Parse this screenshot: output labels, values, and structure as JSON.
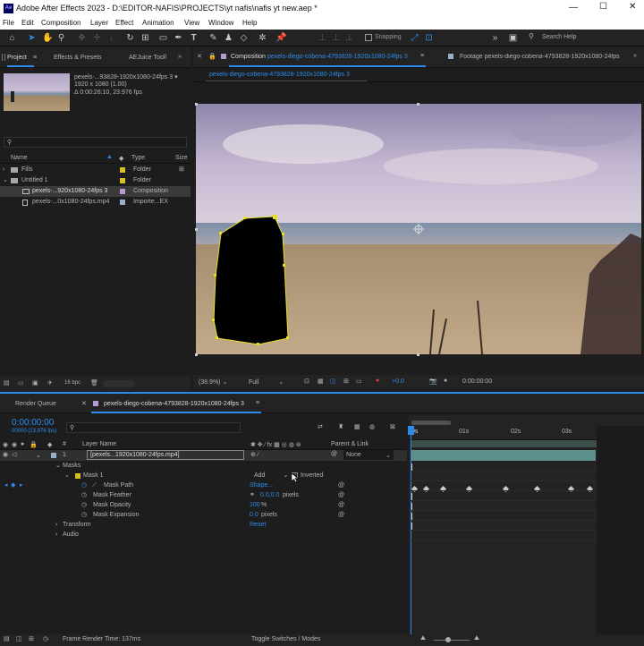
{
  "app": {
    "title": "Adobe After Effects 2023 - D:\\EDITOR-NAFIS\\PROJECTS\\yt nafis\\nafis yt new.aep *",
    "logo": "Ae",
    "win_controls": [
      "—",
      "☐",
      "✕"
    ]
  },
  "menu": [
    "File",
    "Edit",
    "Composition",
    "Layer",
    "Effect",
    "Animation",
    "View",
    "Window",
    "Help"
  ],
  "toolbar": {
    "snapping": "Snapping",
    "search_placeholder": "Search Help"
  },
  "project_panel": {
    "tabs": [
      "Project",
      "Effects & Presets",
      "AEJuice Tooll"
    ],
    "preview": {
      "name": "pexels-...93828-1920x1080-24fps 3 ▾",
      "res": "1920 x 1080 (1.00)",
      "dur": "Δ 0:00:26:10, 23.976 fps"
    },
    "columns": {
      "name": "Name",
      "type": "Type",
      "size": "Size"
    },
    "items": [
      {
        "name": "Fills",
        "type": "Folder"
      },
      {
        "name": "Untitled 1",
        "type": "Folder"
      },
      {
        "name": "pexels-...920x1080-24fps 3",
        "type": "Composition"
      },
      {
        "name": "pexels-...0x1080-24fps.mp4",
        "type": "Importe...EX"
      }
    ],
    "bpc": "16 bpc"
  },
  "comp_panel": {
    "tab_comp_prefix": "Composition",
    "tab_comp_name": "pexels-diego-cobena-4793828-1920x1080-24fps 3",
    "tab_footage": "Footage pexels-diego-cobena-4793828-1920x1080-24fps",
    "subtab": "pexels-diego-cobena-4793828-1920x1080-24fps 3",
    "zoom": "(38.9%)",
    "resolution": "Full",
    "exposure": "+0.0",
    "timecode": "0:00:00:00"
  },
  "timeline": {
    "tab_render": "Render Queue",
    "tab_comp": "pexels-diego-cobena-4793828-1920x1080-24fps 3",
    "timecode": "0:00:00:00",
    "timecode_sub": "00000 (23.976 fps)",
    "cols": {
      "layer": "Layer Name",
      "parent": "Parent & Link"
    },
    "layer": {
      "num": "1",
      "name": "[pexels...1920x1080-24fps.mp4]",
      "parent": "None"
    },
    "props": [
      {
        "label": "Masks"
      },
      {
        "label": "Mask 1",
        "mode": "Add",
        "inverted": "Inverted"
      },
      {
        "label": "Mask Path",
        "value": "Shape..."
      },
      {
        "label": "Mask Feather",
        "value": "0.0,0.0",
        "unit": "pixels"
      },
      {
        "label": "Mask Opacity",
        "value": "100",
        "unit": "%"
      },
      {
        "label": "Mask Expansion",
        "value": "0.0",
        "unit": "pixels"
      },
      {
        "label": "Transform",
        "value": "Reset"
      },
      {
        "label": "Audio"
      }
    ],
    "ruler": [
      "0s",
      "01s",
      "02s",
      "03s",
      "04s"
    ],
    "footer_left": "Frame Render Time: 137ms",
    "footer_mid": "Toggle Switches / Modes"
  }
}
